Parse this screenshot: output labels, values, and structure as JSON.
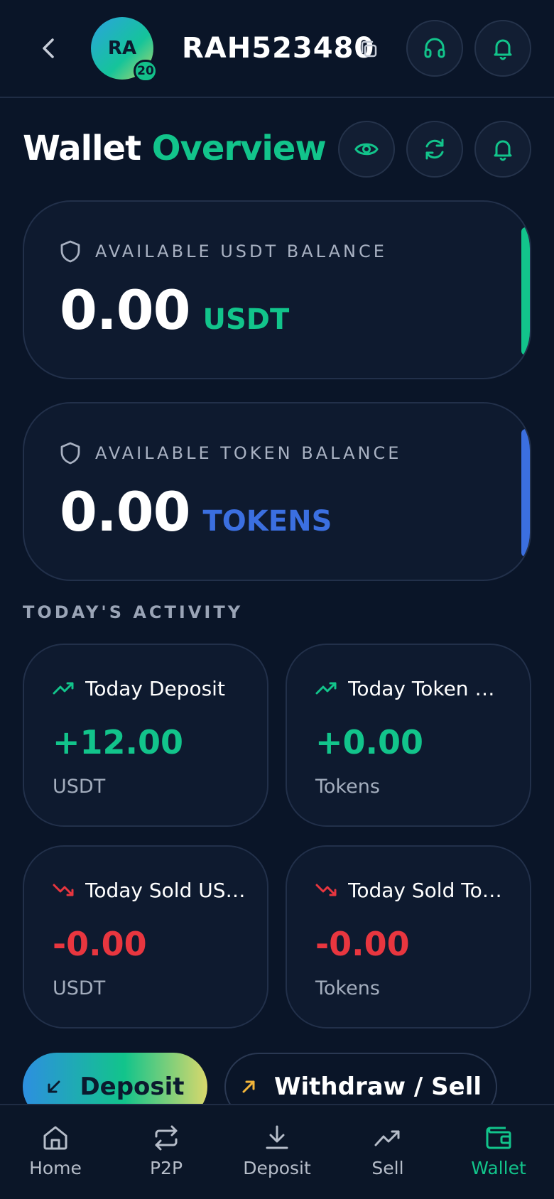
{
  "header": {
    "avatar_initials": "RA",
    "level_badge": "20",
    "user_id": "RAH523480",
    "icons": [
      "chevron-left-icon",
      "copy-icon",
      "headset-icon",
      "bell-icon"
    ]
  },
  "title": {
    "part1": "Wallet",
    "part2": "Overview",
    "icons": [
      "eye-icon",
      "refresh-icon",
      "bell-icon"
    ]
  },
  "balances": [
    {
      "label": "AVAILABLE USDT BALANCE",
      "amount": "0.00",
      "unit": "USDT",
      "accent": "#12c48b"
    },
    {
      "label": "AVAILABLE TOKEN BALANCE",
      "amount": "0.00",
      "unit": "TOKENS",
      "accent": "#3b6fe0"
    }
  ],
  "activity": {
    "heading": "TODAY'S ACTIVITY",
    "cards": [
      {
        "title": "Today Deposit",
        "value": "+12.00",
        "unit": "USDT",
        "trend": "up"
      },
      {
        "title": "Today Token Deposit",
        "value": "+0.00",
        "unit": "Tokens",
        "trend": "up"
      },
      {
        "title": "Today Sold USDT",
        "value": "-0.00",
        "unit": "USDT",
        "trend": "down"
      },
      {
        "title": "Today Sold Tokens",
        "value": "-0.00",
        "unit": "Tokens",
        "trend": "down"
      }
    ]
  },
  "actions": {
    "deposit_label": "Deposit",
    "withdraw_label": "Withdraw / Sell"
  },
  "nav": {
    "items": [
      {
        "label": "Home",
        "icon": "home-icon"
      },
      {
        "label": "P2P",
        "icon": "exchange-icon"
      },
      {
        "label": "Deposit",
        "icon": "download-icon"
      },
      {
        "label": "Sell",
        "icon": "trend-up-icon"
      },
      {
        "label": "Wallet",
        "icon": "wallet-icon",
        "active": true
      }
    ]
  },
  "colors": {
    "background": "#0a1528",
    "accent_green": "#12c48b",
    "accent_blue": "#3b6fe0",
    "negative_red": "#e8363f",
    "card": "#0e1a2f"
  }
}
